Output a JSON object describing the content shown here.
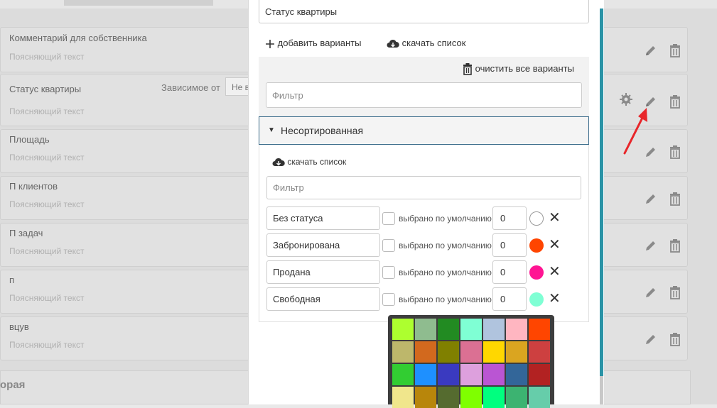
{
  "background": {
    "fields": [
      {
        "name": "Комментарий для собственника",
        "hint": "Поясняющий текст"
      },
      {
        "name": "Статус квартиры",
        "hint": "Поясняющий текст",
        "dependent_label": "Зависимое от",
        "dependent_value": "Не в"
      },
      {
        "name": "Площадь",
        "hint": "Поясняющий текст"
      },
      {
        "name": "П клиентов",
        "hint": "Поясняющий текст"
      },
      {
        "name": "П задач",
        "hint": "Поясняющий текст"
      },
      {
        "name": "п",
        "hint": "Поясняющий текст"
      },
      {
        "name": "вцув",
        "hint": "Поясняющий текст"
      }
    ],
    "section_title": "орая"
  },
  "modal": {
    "field_value": "Статус квартиры",
    "add_variants": "добавить варианты",
    "download_list": "скачать список",
    "clear_all": "очистить все варианты",
    "filter_placeholder": "Фильтр",
    "group": {
      "title": "Несортированная",
      "download_list": "скачать список",
      "filter_placeholder": "Фильтр",
      "options": [
        {
          "label": "Без статуса",
          "default_label": "выбрано по умолчанию",
          "order": "0",
          "color": "#ffffff"
        },
        {
          "label": "Забронирована",
          "default_label": "выбрано по умолчанию",
          "order": "0",
          "color": "#ff4500"
        },
        {
          "label": "Продана",
          "default_label": "выбрано по умолчанию",
          "order": "0",
          "color": "#ff1493"
        },
        {
          "label": "Свободная",
          "default_label": "выбрано по умолчанию",
          "order": "0",
          "color": "#7fffd4"
        }
      ]
    },
    "palette": [
      [
        "#adff2f",
        "#8fbc8f",
        "#228b22",
        "#7fffd4",
        "#b0c4de",
        "#ffb6c1",
        "#ff4500"
      ],
      [
        "#bdb76b",
        "#d2691e",
        "#808000",
        "#db7093",
        "#ffd700",
        "#daa520",
        "#cd4040"
      ],
      [
        "#32cd32",
        "#1e90ff",
        "#3a3ac0",
        "#dda0dd",
        "#ba55d3",
        "#336699",
        "#b22222"
      ],
      [
        "#f0e68c",
        "#b8860b",
        "#556b2f",
        "#7fff00",
        "#00ff7f",
        "#3cb371",
        "#66cdaa"
      ]
    ]
  },
  "icons": {
    "edit": "pencil-icon",
    "delete": "trash-icon",
    "settings": "gear-icon",
    "add": "plus-icon",
    "download": "cloud-download-icon",
    "remove": "close-icon"
  }
}
